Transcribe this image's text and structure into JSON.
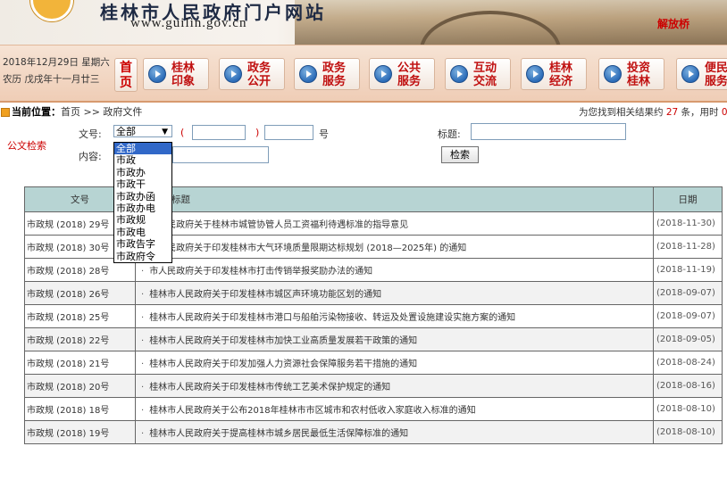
{
  "banner": {
    "site_title": "桂林市人民政府门户网站",
    "site_url": "www.guilin.gov.cn",
    "scene_label": "解放桥"
  },
  "date_block": {
    "solar": "2018年12月29日 星期六",
    "lunar": "农历 戊戌年十一月廿三"
  },
  "nav": {
    "home": "首页",
    "items": [
      {
        "label": "桂林印象"
      },
      {
        "label": "政务公开"
      },
      {
        "label": "政务服务"
      },
      {
        "label": "公共服务"
      },
      {
        "label": "互动交流"
      },
      {
        "label": "桂林经济"
      },
      {
        "label": "投资桂林"
      },
      {
        "label": "便民服务"
      }
    ]
  },
  "location": {
    "label": "当前位置：",
    "path": "首页 >> 政府文件",
    "result_prefix": "为您找到相关结果约 ",
    "result_count": "27",
    "result_mid": " 条，用时 ",
    "result_time": "0"
  },
  "search": {
    "section_label": "公文检索",
    "doc_no_label": "文号:",
    "doc_no_selected": "全部",
    "paren_open": "(",
    "paren_close": ")",
    "number_suffix": "号",
    "title_label": "标题:",
    "content_label": "内容:",
    "search_button": "检索",
    "doc_no_options": [
      "全部",
      "市政",
      "市政办",
      "市政干",
      "市政办函",
      "市政办电",
      "市政规",
      "市政电",
      "市政告字",
      "市政府令"
    ]
  },
  "table": {
    "headers": {
      "doc_no": "文号",
      "title": "标题",
      "date": "日期"
    },
    "rows": [
      {
        "doc_no": "市政规 (2018) 29号",
        "title": "市人民政府关于桂林市城管协管人员工资福利待遇标准的指导意见",
        "date": "(2018-11-30)"
      },
      {
        "doc_no": "市政规 (2018) 30号",
        "title": "市人民政府关于印发桂林市大气环境质量限期达标规划 (2018—2025年) 的通知",
        "date": "(2018-11-28)"
      },
      {
        "doc_no": "市政规 (2018) 28号",
        "title": "市人民政府关于印发桂林市打击传销举报奖励办法的通知",
        "date": "(2018-11-19)"
      },
      {
        "doc_no": "市政规 (2018) 26号",
        "title": "桂林市人民政府关于印发桂林市城区声环境功能区划的通知",
        "date": "(2018-09-07)"
      },
      {
        "doc_no": "市政规 (2018) 25号",
        "title": "桂林市人民政府关于印发桂林市港口与船舶污染物接收、转运及处置设施建设实施方案的通知",
        "date": "(2018-09-07)"
      },
      {
        "doc_no": "市政规 (2018) 22号",
        "title": "桂林市人民政府关于印发桂林市加快工业高质量发展若干政策的通知",
        "date": "(2018-09-05)"
      },
      {
        "doc_no": "市政规 (2018) 21号",
        "title": "桂林市人民政府关于印发加强人力资源社会保障服务若干措施的通知",
        "date": "(2018-08-24)"
      },
      {
        "doc_no": "市政规 (2018) 20号",
        "title": "桂林市人民政府关于印发桂林市传统工艺美术保护规定的通知",
        "date": "(2018-08-16)"
      },
      {
        "doc_no": "市政规 (2018) 18号",
        "title": "桂林市人民政府关于公布2018年桂林市市区城市和农村低收入家庭收入标准的通知",
        "date": "(2018-08-10)"
      },
      {
        "doc_no": "市政规 (2018) 19号",
        "title": "桂林市人民政府关于提高桂林市城乡居民最低生活保障标准的通知",
        "date": "(2018-08-10)"
      }
    ]
  }
}
